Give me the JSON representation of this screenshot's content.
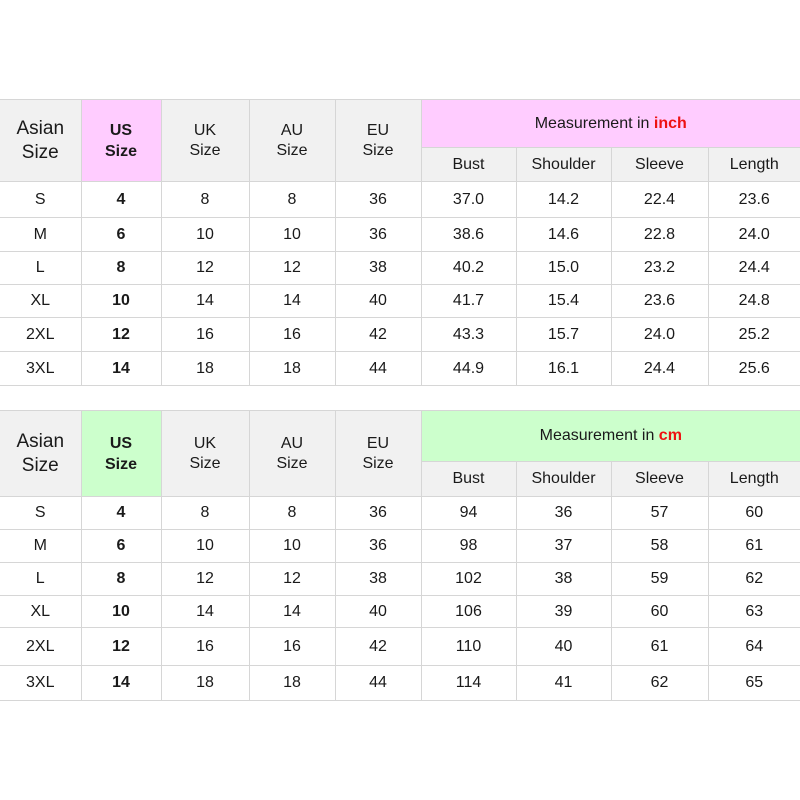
{
  "colors": {
    "inch_highlight": "#ffccff",
    "cm_highlight": "#ccffcc",
    "header_background": "#f1f1f1",
    "unit_text": "#ee1111",
    "grid_line": "#d6d6d6"
  },
  "inch_chart": {
    "header": {
      "asian": [
        "Asian",
        "Size"
      ],
      "us": [
        "US",
        "Size"
      ],
      "uk": [
        "UK",
        "Size"
      ],
      "au": [
        "AU",
        "Size"
      ],
      "eu": [
        "EU",
        "Size"
      ],
      "measurement_prefix": "Measurement in ",
      "measurement_unit": "inch",
      "bust": "Bust",
      "shoulder": "Shoulder",
      "sleeve": "Sleeve",
      "length": "Length"
    },
    "rows": [
      {
        "asian": "S",
        "us": "4",
        "uk": "8",
        "au": "8",
        "eu": "36",
        "bust": "37.0",
        "shoulder": "14.2",
        "sleeve": "22.4",
        "length": "23.6"
      },
      {
        "asian": "M",
        "us": "6",
        "uk": "10",
        "au": "10",
        "eu": "36",
        "bust": "38.6",
        "shoulder": "14.6",
        "sleeve": "22.8",
        "length": "24.0"
      },
      {
        "asian": "L",
        "us": "8",
        "uk": "12",
        "au": "12",
        "eu": "38",
        "bust": "40.2",
        "shoulder": "15.0",
        "sleeve": "23.2",
        "length": "24.4"
      },
      {
        "asian": "XL",
        "us": "10",
        "uk": "14",
        "au": "14",
        "eu": "40",
        "bust": "41.7",
        "shoulder": "15.4",
        "sleeve": "23.6",
        "length": "24.8"
      },
      {
        "asian": "2XL",
        "us": "12",
        "uk": "16",
        "au": "16",
        "eu": "42",
        "bust": "43.3",
        "shoulder": "15.7",
        "sleeve": "24.0",
        "length": "25.2"
      },
      {
        "asian": "3XL",
        "us": "14",
        "uk": "18",
        "au": "18",
        "eu": "44",
        "bust": "44.9",
        "shoulder": "16.1",
        "sleeve": "24.4",
        "length": "25.6"
      }
    ]
  },
  "cm_chart": {
    "header": {
      "asian": [
        "Asian",
        "Size"
      ],
      "us": [
        "US",
        "Size"
      ],
      "uk": [
        "UK",
        "Size"
      ],
      "au": [
        "AU",
        "Size"
      ],
      "eu": [
        "EU",
        "Size"
      ],
      "measurement_prefix": "Measurement in ",
      "measurement_unit": "cm",
      "bust": "Bust",
      "shoulder": "Shoulder",
      "sleeve": "Sleeve",
      "length": "Length"
    },
    "rows": [
      {
        "asian": "S",
        "us": "4",
        "uk": "8",
        "au": "8",
        "eu": "36",
        "bust": "94",
        "shoulder": "36",
        "sleeve": "57",
        "length": "60"
      },
      {
        "asian": "M",
        "us": "6",
        "uk": "10",
        "au": "10",
        "eu": "36",
        "bust": "98",
        "shoulder": "37",
        "sleeve": "58",
        "length": "61"
      },
      {
        "asian": "L",
        "us": "8",
        "uk": "12",
        "au": "12",
        "eu": "38",
        "bust": "102",
        "shoulder": "38",
        "sleeve": "59",
        "length": "62"
      },
      {
        "asian": "XL",
        "us": "10",
        "uk": "14",
        "au": "14",
        "eu": "40",
        "bust": "106",
        "shoulder": "39",
        "sleeve": "60",
        "length": "63"
      },
      {
        "asian": "2XL",
        "us": "12",
        "uk": "16",
        "au": "16",
        "eu": "42",
        "bust": "110",
        "shoulder": "40",
        "sleeve": "61",
        "length": "64"
      },
      {
        "asian": "3XL",
        "us": "14",
        "uk": "18",
        "au": "18",
        "eu": "44",
        "bust": "114",
        "shoulder": "41",
        "sleeve": "62",
        "length": "65"
      }
    ]
  }
}
